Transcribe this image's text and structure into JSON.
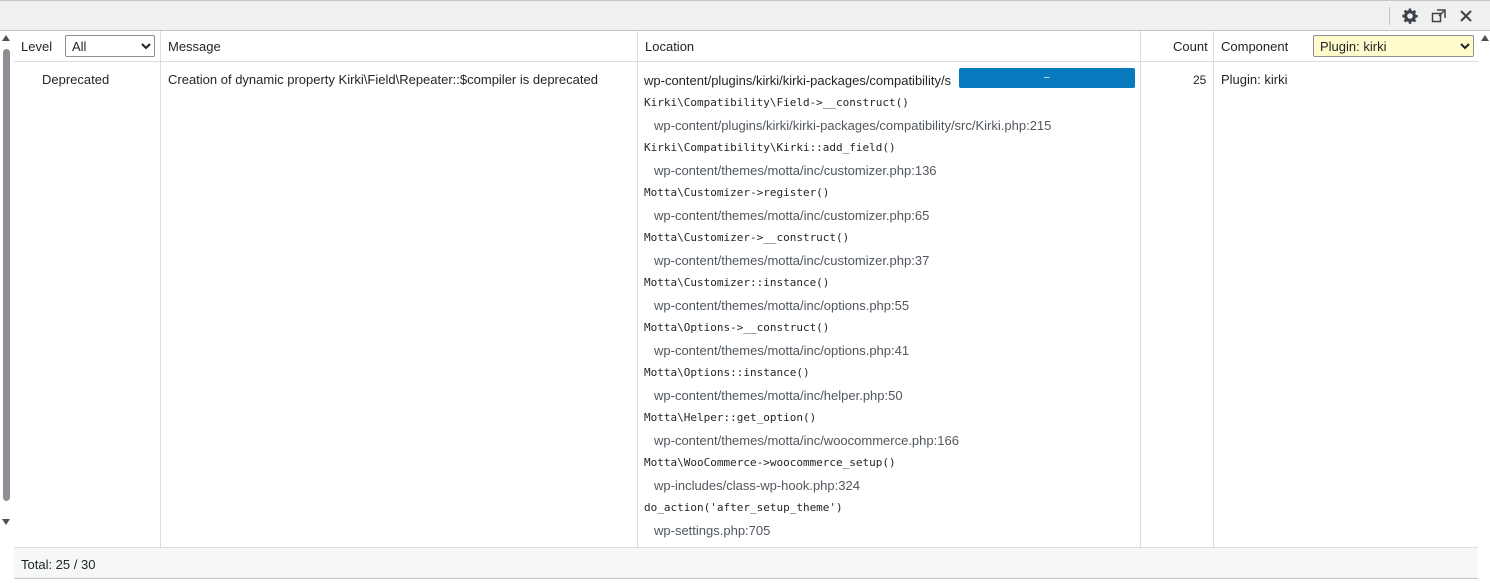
{
  "toolbar": {
    "settings_icon": "gear-icon",
    "popout_icon": "window-popout-icon",
    "close_icon": "close-icon"
  },
  "columns": {
    "level": "Level",
    "message": "Message",
    "location": "Location",
    "count": "Count",
    "component": "Component"
  },
  "filters": {
    "level_selected": "All",
    "component_selected": "Plugin: kirki"
  },
  "row": {
    "level": "Deprecated",
    "message": "Creation of dynamic property Kirki\\Field\\Repeater::$compiler is deprecated",
    "location_head": "wp-content/plugins/kirki/kirki-packages/compatibility/s",
    "count": "25",
    "component": "Plugin: kirki",
    "stack": [
      {
        "call": "Kirki\\Compatibility\\Field->__construct()",
        "path": "wp-content/plugins/kirki/kirki-packages/compatibility/src/Kirki.php:215"
      },
      {
        "call": "Kirki\\Compatibility\\Kirki::add_field()",
        "path": "wp-content/themes/motta/inc/customizer.php:136"
      },
      {
        "call": "Motta\\Customizer->register()",
        "path": "wp-content/themes/motta/inc/customizer.php:65"
      },
      {
        "call": "Motta\\Customizer->__construct()",
        "path": "wp-content/themes/motta/inc/customizer.php:37"
      },
      {
        "call": "Motta\\Customizer::instance()",
        "path": "wp-content/themes/motta/inc/options.php:55"
      },
      {
        "call": "Motta\\Options->__construct()",
        "path": "wp-content/themes/motta/inc/options.php:41"
      },
      {
        "call": "Motta\\Options::instance()",
        "path": "wp-content/themes/motta/inc/helper.php:50"
      },
      {
        "call": "Motta\\Helper::get_option()",
        "path": "wp-content/themes/motta/inc/woocommerce.php:166"
      },
      {
        "call": "Motta\\WooCommerce->woocommerce_setup()",
        "path": "wp-includes/class-wp-hook.php:324"
      },
      {
        "call": "do_action('after_setup_theme')",
        "path": "wp-settings.php:705"
      }
    ]
  },
  "footer": {
    "total": "Total: 25 / 30"
  },
  "colors": {
    "redaction": "#0a7abf",
    "component_select_bg": "#fffbcc"
  }
}
